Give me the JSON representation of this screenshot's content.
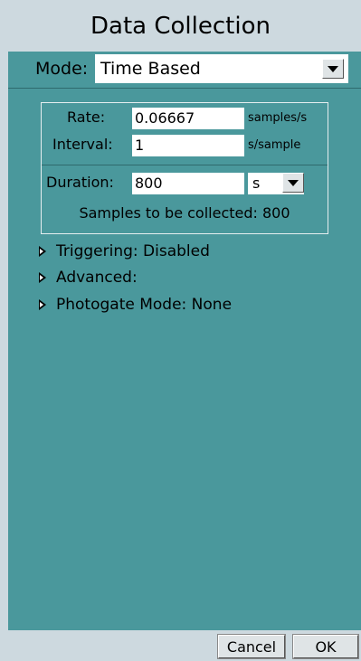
{
  "title": "Data Collection",
  "mode": {
    "label": "Mode:",
    "value": "Time Based"
  },
  "rate": {
    "label": "Rate:",
    "value": "0.06667",
    "unit": "samples/s"
  },
  "interval": {
    "label": "Interval:",
    "value": "1",
    "unit": "s/sample"
  },
  "duration": {
    "label": "Duration:",
    "value": "800",
    "unit": "s"
  },
  "samples_text": "Samples to be collected: 800",
  "sections": [
    {
      "label": "Triggering: Disabled"
    },
    {
      "label": "Advanced:"
    },
    {
      "label": "Photogate Mode: None"
    }
  ],
  "buttons": {
    "cancel": "Cancel",
    "ok": "OK"
  },
  "colors": {
    "panel_bg": "#4a989c",
    "chrome_bg": "#cdd9df"
  },
  "icons": {
    "dropdown": "chevron-down-icon",
    "expander": "triangle-right-icon"
  }
}
